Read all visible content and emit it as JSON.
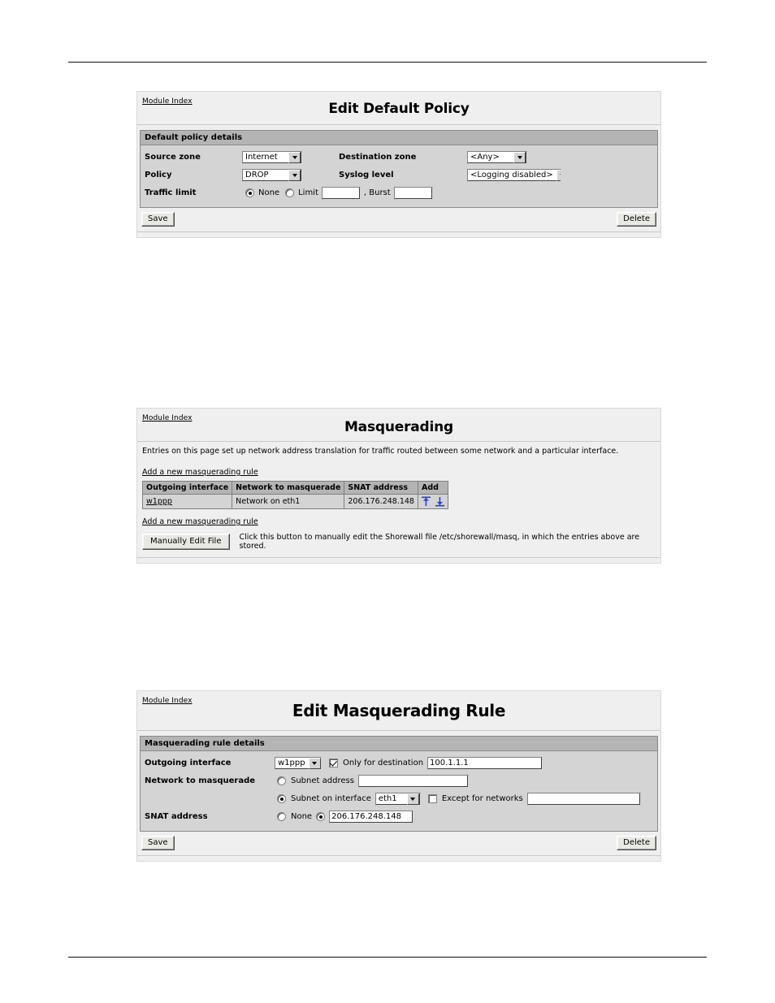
{
  "document": {
    "header_rule": true,
    "footer_rule": true
  },
  "panel1": {
    "module_index": "Module Index",
    "title": "Edit Default Policy",
    "fieldset_title": "Default policy details",
    "labels": {
      "source_zone": "Source zone",
      "destination_zone": "Destination zone",
      "policy": "Policy",
      "syslog_level": "Syslog level",
      "traffic_limit": "Traffic limit"
    },
    "values": {
      "source_zone": "Internet",
      "destination_zone": "<Any>",
      "policy": "DROP",
      "syslog_level": "<Logging disabled>",
      "traffic_none": "None",
      "traffic_limit_opt": "Limit",
      "traffic_burst_opt": ", Burst",
      "limit_value": "",
      "burst_value": ""
    },
    "selected": {
      "traffic_limit_mode": "none"
    },
    "buttons": {
      "save": "Save",
      "delete": "Delete"
    }
  },
  "panel2": {
    "module_index": "Module Index",
    "title": "Masquerading",
    "description": "Entries on this page set up network address translation for traffic routed between some network and a particular interface.",
    "add_link_top": "Add a new masquerading rule",
    "add_link_bottom": "Add a new masquerading rule",
    "table": {
      "headers": [
        "Outgoing interface",
        "Network to masquerade",
        "SNAT address",
        "Add"
      ],
      "rows": [
        {
          "outgoing_interface": "w1ppp",
          "network_to_masquerade": "Network on eth1",
          "snat_address": "206.176.248.148",
          "add_icons": [
            "insert-above-icon",
            "insert-below-icon"
          ]
        }
      ]
    },
    "edit_file_button": "Manually Edit File",
    "edit_file_note": "Click this button to manually edit the Shorewall file /etc/shorewall/masq, in which the entries above are stored."
  },
  "panel3": {
    "module_index": "Module Index",
    "title": "Edit Masquerading Rule",
    "fieldset_title": "Masquerading rule details",
    "labels": {
      "outgoing_interface": "Outgoing interface",
      "only_for_destination": "Only for destination",
      "network_to_masquerade": "Network to masquerade",
      "subnet_address": "Subnet address",
      "subnet_on_interface": "Subnet on interface",
      "except_for_networks": "Except for networks",
      "snat_address": "SNAT address",
      "snat_none": "None"
    },
    "values": {
      "outgoing_interface": "w1ppp",
      "only_for_destination": "100.1.1.1",
      "subnet_address": "",
      "subnet_on_interface": "eth1",
      "except_for_networks": "",
      "snat_address": "206.176.248.148"
    },
    "selected": {
      "only_for_destination_checked": true,
      "network_mode": "subnet-on-interface",
      "except_for_networks_checked": false,
      "snat_mode": "address"
    },
    "buttons": {
      "save": "Save",
      "delete": "Delete"
    }
  },
  "colors": {
    "panel_bg": "#efefef",
    "fieldset_bg": "#d4d4d4",
    "fieldset_header_bg": "#b4b4b4",
    "icon_blue": "#2b3fd4",
    "button_face": "#e9e9e4"
  }
}
